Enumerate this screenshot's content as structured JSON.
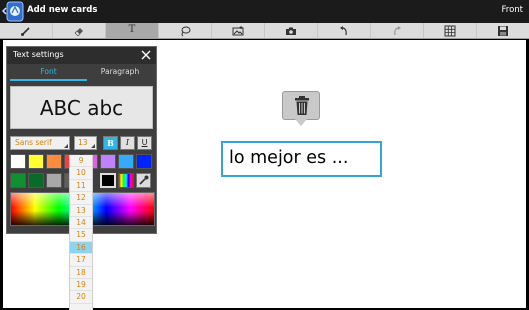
{
  "app": {
    "title": "Add new cards",
    "mode_label": "Front",
    "icon": "app-logo-icon"
  },
  "toolbar": {
    "tools": [
      {
        "name": "brush-tool",
        "icon": "brush-icon"
      },
      {
        "name": "eraser-tool",
        "icon": "eraser-icon"
      },
      {
        "name": "text-tool",
        "icon": "text-icon",
        "glyph": "T",
        "active": true
      },
      {
        "name": "select-tool",
        "icon": "lasso-icon"
      },
      {
        "name": "insert-image-tool",
        "icon": "image-icon"
      },
      {
        "name": "camera-tool",
        "icon": "camera-icon"
      },
      {
        "name": "undo-tool",
        "icon": "undo-icon"
      },
      {
        "name": "redo-tool",
        "icon": "redo-icon"
      },
      {
        "name": "grid-tool",
        "icon": "grid-icon"
      },
      {
        "name": "save-tool",
        "icon": "save-icon"
      }
    ]
  },
  "text_settings": {
    "title": "Text settings",
    "tabs": {
      "font": "Font",
      "paragraph": "Paragraph"
    },
    "preview_text": "ABC abc",
    "font_family": "Sans serif",
    "font_size": "13",
    "style_buttons": {
      "bold": "B",
      "italic": "I",
      "underline": "U"
    },
    "colors_row1": [
      "#ffffff",
      "#ffff33",
      "#ff8c3c",
      "#ff3b3b",
      "#e060e0",
      "#c080ff",
      "#33aaff",
      "#0022ff"
    ],
    "colors_row2": [
      "#109030",
      "#0a6a2a",
      "#a8a8a8",
      "#606060"
    ],
    "size_options": [
      "9",
      "10",
      "11",
      "12",
      "13",
      "14",
      "15",
      "16",
      "17",
      "18",
      "19",
      "20"
    ],
    "selected_size_option": "16"
  },
  "card": {
    "text": "lo mejor es ..."
  },
  "colors": {
    "accent": "#33b5e5",
    "option_text": "#d4830f"
  }
}
